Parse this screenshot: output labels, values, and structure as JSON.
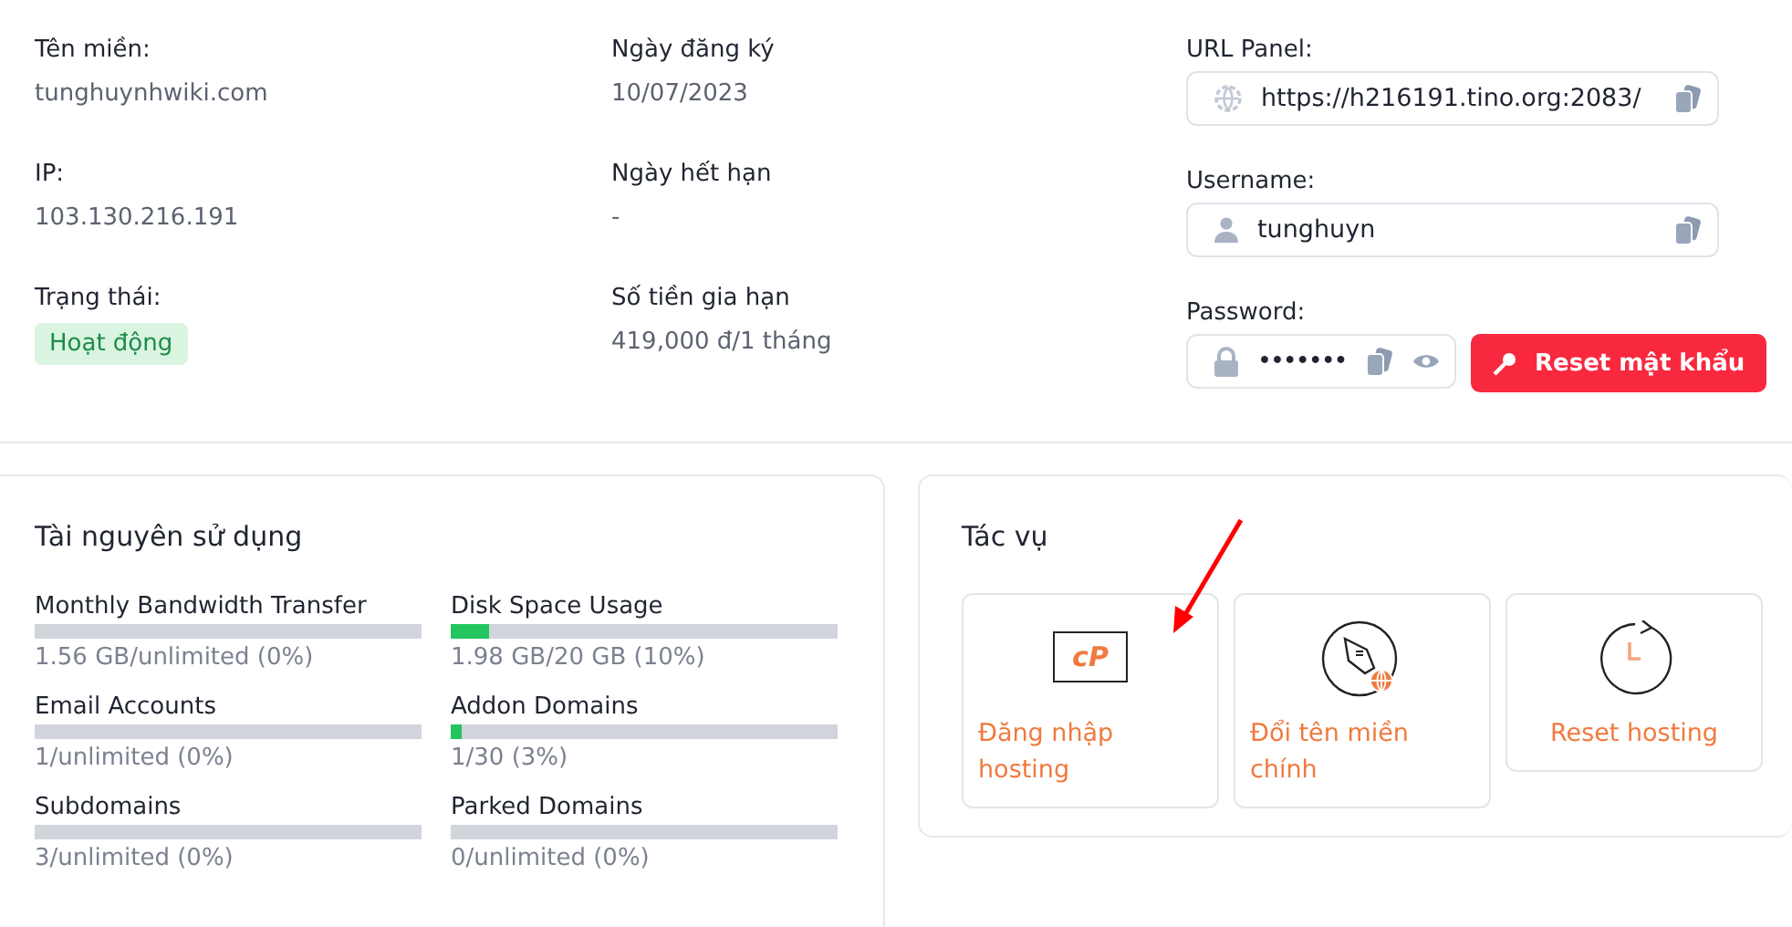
{
  "info_columns": [
    {
      "fields": [
        {
          "label": "Tên miền:",
          "value": "tunghuynhwiki.com",
          "kind": "text"
        },
        {
          "label": "IP:",
          "value": "103.130.216.191",
          "kind": "text"
        },
        {
          "label": "Trạng thái:",
          "value": "Hoạt động",
          "kind": "badge"
        }
      ]
    },
    {
      "fields": [
        {
          "label": "Ngày đăng ký",
          "value": "10/07/2023",
          "kind": "text"
        },
        {
          "label": "Ngày hết hạn",
          "value": "-",
          "kind": "text"
        },
        {
          "label": "Số tiền gia hạn",
          "value": "419,000 đ/1 tháng",
          "kind": "text"
        }
      ]
    }
  ],
  "credentials": [
    {
      "label": "URL Panel:",
      "value": "https://h216191.tino.org:2083/",
      "kind": "url"
    },
    {
      "label": "Username:",
      "value": "tunghuyn",
      "kind": "user"
    },
    {
      "label": "Password:",
      "value": "•••••••",
      "kind": "password"
    }
  ],
  "reset_password_button": "Reset mật khẩu",
  "resources": {
    "title": "Tài nguyên sử dụng",
    "items": [
      {
        "name": "Monthly Bandwidth Transfer",
        "level": 0,
        "reading": "1.56 GB/unlimited (0%)"
      },
      {
        "name": "Disk Space Usage",
        "level": 0.1,
        "reading": "1.98 GB/20 GB (10%)"
      },
      {
        "name": "Email Accounts",
        "level": 0,
        "reading": "1/unlimited (0%)"
      },
      {
        "name": "Addon Domains",
        "level": 0.03,
        "reading": "1/30 (3%)"
      },
      {
        "name": "Subdomains",
        "level": 0,
        "reading": "3/unlimited (0%)"
      },
      {
        "name": "Parked Domains",
        "level": 0,
        "reading": "0/unlimited (0%)"
      }
    ]
  },
  "tasks": {
    "title": "Tác vụ",
    "items": [
      {
        "kind": "cpanel",
        "logo_text": "cP",
        "label": "Đăng nhập hosting"
      },
      {
        "kind": "rename",
        "label": "Đổi tên miền chính"
      },
      {
        "kind": "reset",
        "label": "Reset hosting"
      }
    ]
  }
}
